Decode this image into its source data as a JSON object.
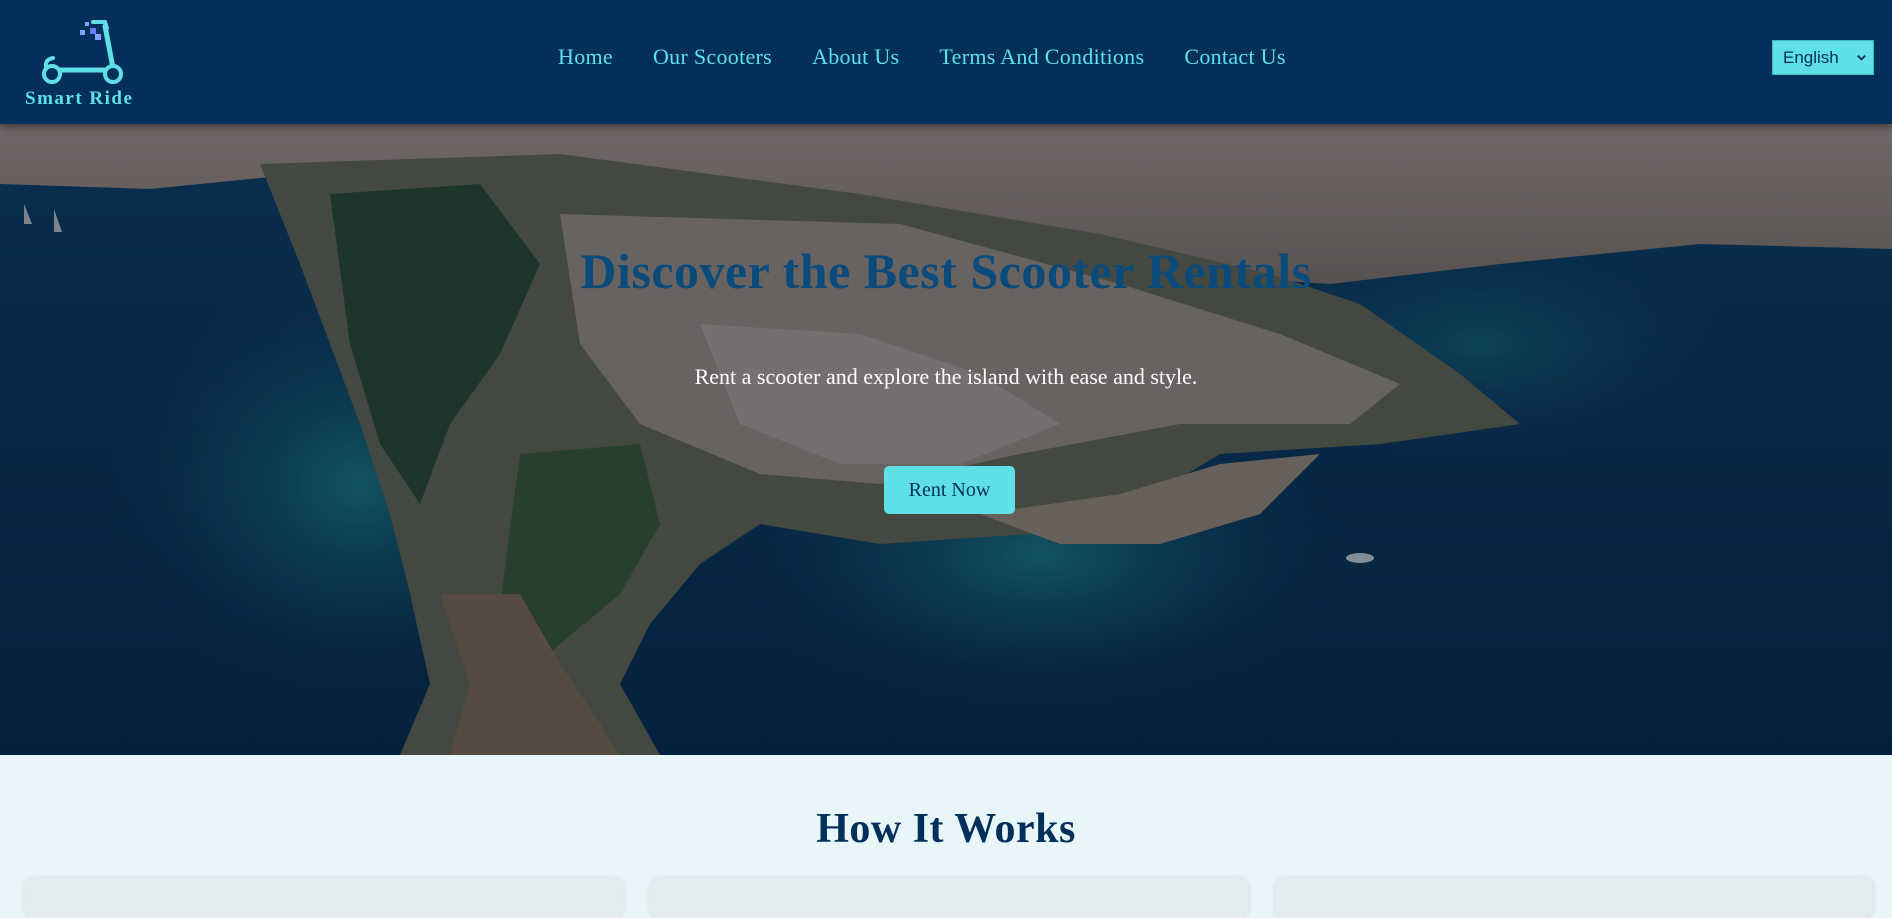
{
  "header": {
    "logo_text": "Smart Ride",
    "nav": [
      {
        "label": "Home"
      },
      {
        "label": "Our Scooters"
      },
      {
        "label": "About Us"
      },
      {
        "label": "Terms And Conditions"
      },
      {
        "label": "Contact Us"
      }
    ],
    "language": {
      "selected": "English",
      "icon": "chevron-down-icon"
    }
  },
  "hero": {
    "title": "Discover the Best Scooter Rentals",
    "subtitle": "Rent a scooter and explore the island with ease and style.",
    "cta_label": "Rent Now"
  },
  "how_it_works": {
    "title": "How It Works"
  },
  "colors": {
    "header_bg": "#03305b",
    "accent": "#5ee0e6",
    "section_bg": "#e8f6fa",
    "hero_title": "#0b4b7c"
  }
}
